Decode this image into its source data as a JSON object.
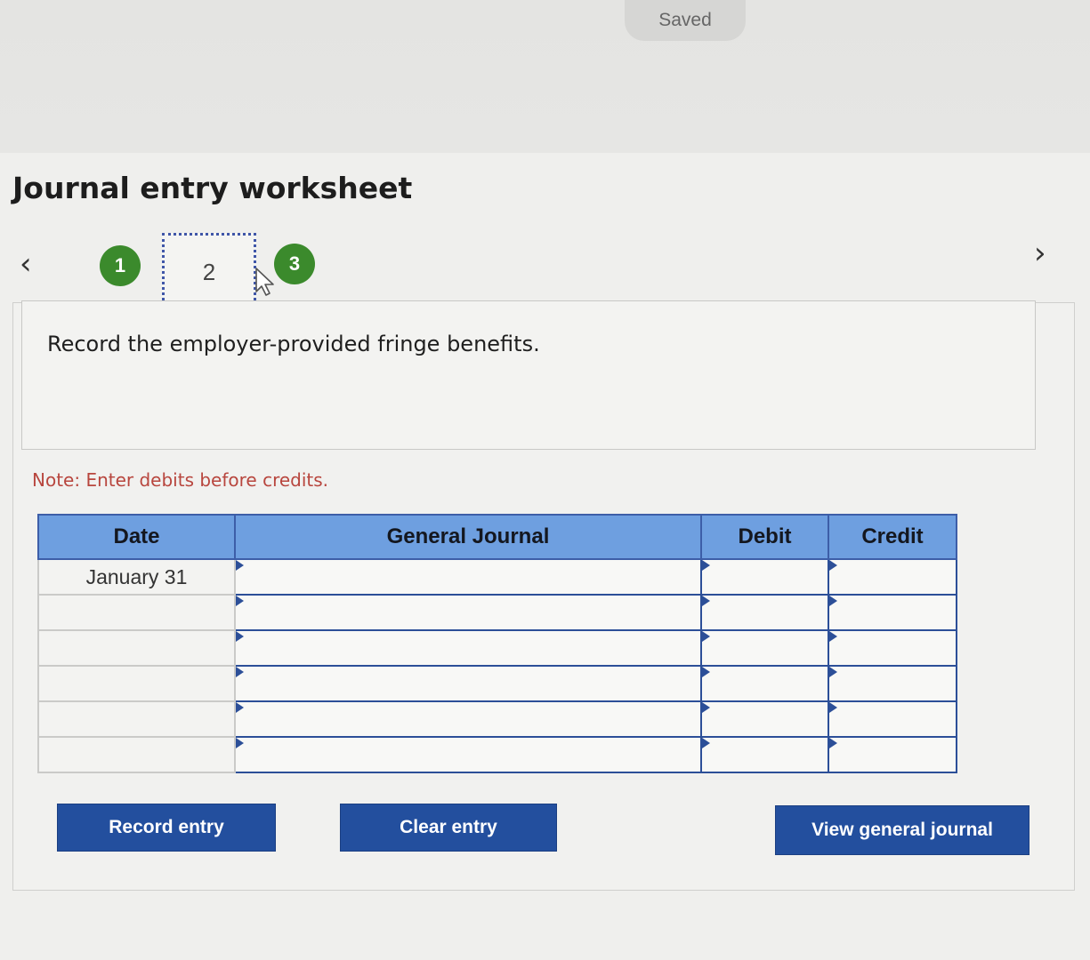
{
  "status": {
    "saved_label": "Saved"
  },
  "worksheet": {
    "title": "Journal entry worksheet",
    "steps": [
      {
        "label": "1",
        "state": "done"
      },
      {
        "label": "2",
        "state": "current"
      },
      {
        "label": "3",
        "state": "done"
      }
    ],
    "prompt": "Record the employer-provided fringe benefits.",
    "note": "Note: Enter debits before credits."
  },
  "table": {
    "headers": {
      "date": "Date",
      "journal": "General Journal",
      "debit": "Debit",
      "credit": "Credit"
    },
    "rows": [
      {
        "date": "January 31",
        "journal": "",
        "debit": "",
        "credit": ""
      },
      {
        "date": "",
        "journal": "",
        "debit": "",
        "credit": ""
      },
      {
        "date": "",
        "journal": "",
        "debit": "",
        "credit": ""
      },
      {
        "date": "",
        "journal": "",
        "debit": "",
        "credit": ""
      },
      {
        "date": "",
        "journal": "",
        "debit": "",
        "credit": ""
      },
      {
        "date": "",
        "journal": "",
        "debit": "",
        "credit": ""
      }
    ]
  },
  "actions": {
    "record_label": "Record entry",
    "clear_label": "Clear entry",
    "view_label": "View general journal"
  },
  "colors": {
    "accent_blue": "#234f9e",
    "header_blue": "#6e9fe0",
    "step_green": "#3b8a2c",
    "note_red": "#b8463e"
  },
  "icons": {
    "prev": "chevron-left-icon",
    "next": "chevron-right-icon",
    "cursor": "mouse-pointer-icon"
  }
}
